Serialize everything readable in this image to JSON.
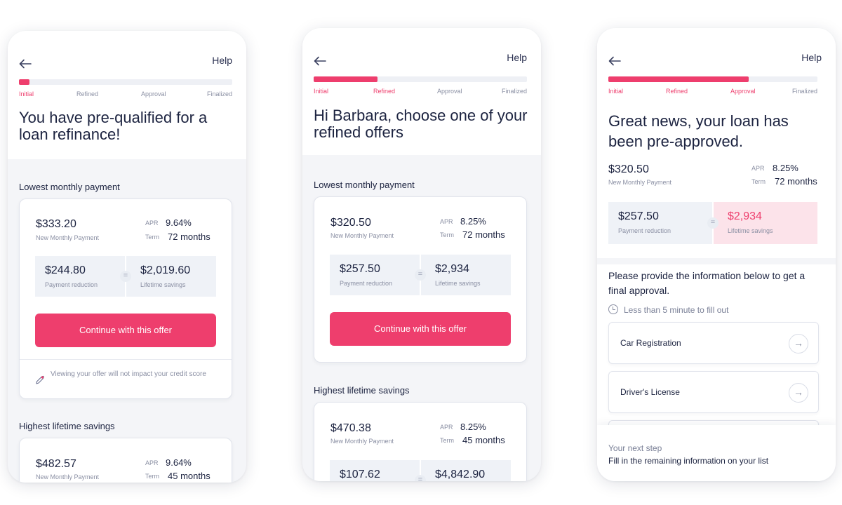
{
  "progress_steps": [
    "Initial",
    "Refined",
    "Approval",
    "Finalized"
  ],
  "help_label": "Help",
  "brand_color": "#ee3e6d",
  "phones": [
    {
      "progress_fraction": 0.05,
      "active_steps": 1,
      "headline": "You have pre-qualified for a loan refinance!",
      "sections": [
        {
          "title": "Lowest monthly payment",
          "monthly_payment": "$333.20",
          "monthly_payment_label": "New Monthly Payment",
          "apr_label": "APR",
          "apr": "9.64%",
          "term_label": "Term",
          "term": "72 months",
          "payment_reduction": "$244.80",
          "payment_reduction_label": "Payment reduction",
          "lifetime_savings": "$2,019.60",
          "lifetime_savings_label": "Lifetime savings",
          "cta": "Continue with this offer",
          "note": "Viewing your offer will not impact your credit score"
        },
        {
          "title": "Highest lifetime savings",
          "monthly_payment": "$482.57",
          "monthly_payment_label": "New Monthly Payment",
          "apr_label": "APR",
          "apr": "9.64%",
          "term_label": "Term",
          "term": "45 months"
        }
      ]
    },
    {
      "progress_fraction": 0.3,
      "active_steps": 2,
      "headline": "Hi Barbara, choose one of your refined offers",
      "sections": [
        {
          "title": "Lowest monthly payment",
          "monthly_payment": "$320.50",
          "monthly_payment_label": "New Monthly Payment",
          "apr_label": "APR",
          "apr": "8.25%",
          "term_label": "Term",
          "term": "72 months",
          "payment_reduction": "$257.50",
          "payment_reduction_label": "Payment reduction",
          "lifetime_savings": "$2,934",
          "lifetime_savings_label": "Lifetime savings",
          "cta": "Continue with this offer"
        },
        {
          "title": "Highest lifetime savings",
          "monthly_payment": "$470.38",
          "monthly_payment_label": "New Monthly Payment",
          "apr_label": "APR",
          "apr": "8.25%",
          "term_label": "Term",
          "term": "45 months",
          "payment_reduction": "$107.62",
          "lifetime_savings": "$4,842.90"
        }
      ]
    },
    {
      "progress_fraction": 0.67,
      "active_steps": 3,
      "headline": "Great news, your loan has been pre-approved.",
      "monthly_payment": "$320.50",
      "monthly_payment_label": "New Monthly Payment",
      "apr_label": "APR",
      "apr": "8.25%",
      "term_label": "Term",
      "term": "72 months",
      "payment_reduction": "$257.50",
      "payment_reduction_label": "Payment reduction",
      "lifetime_savings": "$2,934",
      "lifetime_savings_label": "Lifetime savings",
      "info_heading": "Please provide the information below to get a final approval.",
      "time_estimate": "Less than 5 minute to fill out",
      "documents": [
        "Car Registration",
        "Driver's License"
      ],
      "next_step_label": "Your next step",
      "next_step_text": "Fill in the remaining information on your list"
    }
  ]
}
